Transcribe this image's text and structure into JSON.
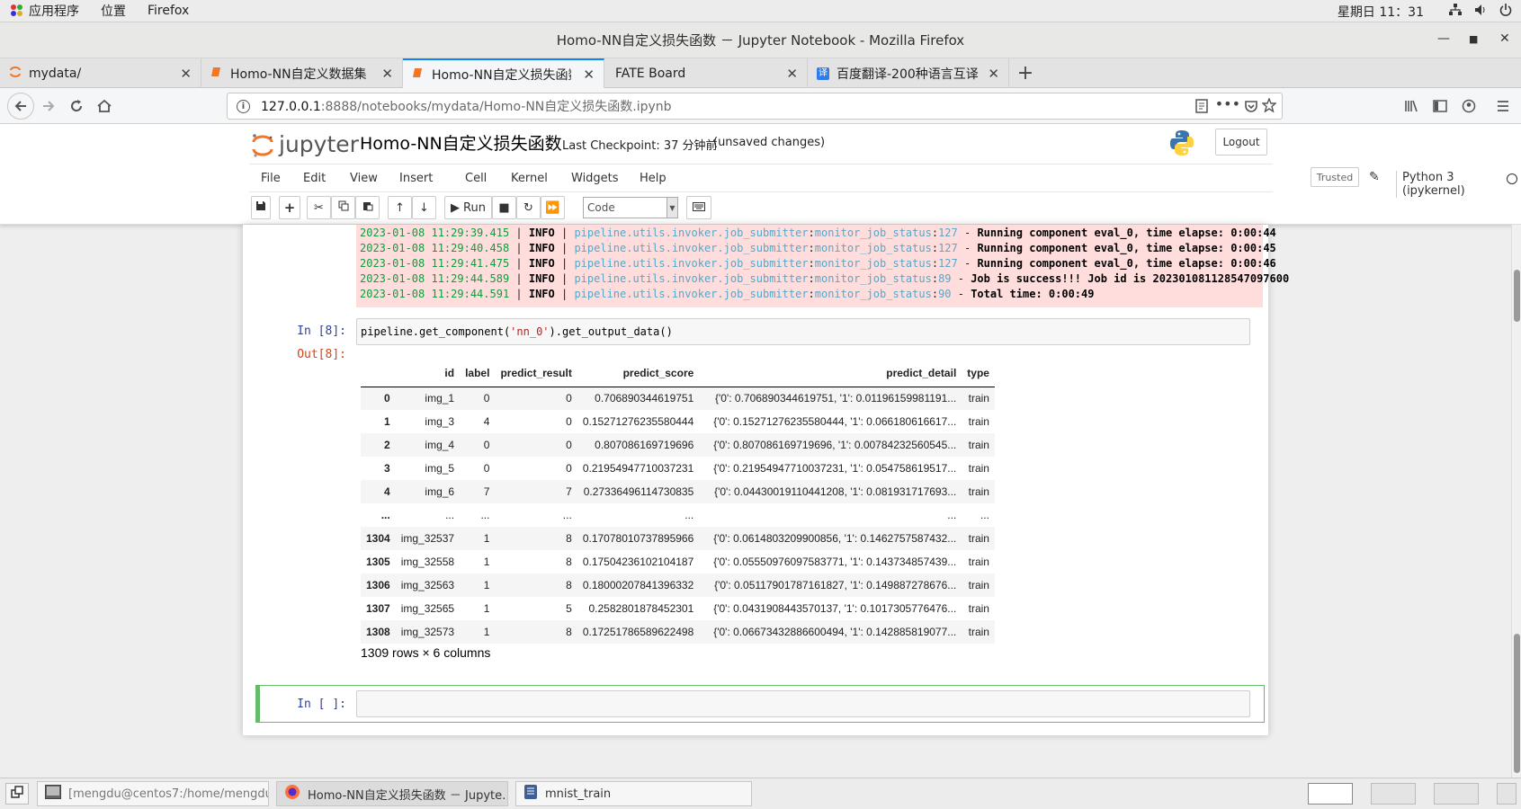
{
  "topbar": {
    "apps": "应用程序",
    "places": "位置",
    "app": "Firefox",
    "clock": "星期日 11：31"
  },
  "window": {
    "title": "Homo-NN自定义损失函数 － Jupyter Notebook - Mozilla Firefox"
  },
  "tabs": [
    {
      "label": "mydata/"
    },
    {
      "label": "Homo-NN自定义数据集"
    },
    {
      "label": "Homo-NN自定义损失函数"
    },
    {
      "label": "FATE Board"
    },
    {
      "label": "百度翻译-200种语言互译"
    }
  ],
  "url": {
    "host": "127.0.0.1",
    "rest": ":8888/notebooks/mydata/Homo-NN自定义损失函数.ipynb"
  },
  "jupyter": {
    "logo_text": "jupyter",
    "notebook_title": "Homo-NN自定义损失函数",
    "checkpoint": "Last Checkpoint: 37 分钟前",
    "unsaved": "(unsaved changes)",
    "logout": "Logout",
    "menus": [
      "File",
      "Edit",
      "View",
      "Insert",
      "Cell",
      "Kernel",
      "Widgets",
      "Help"
    ],
    "trusted": "Trusted",
    "kernel": "Python 3 (ipykernel)",
    "run_label": "Run",
    "cell_type": "Code"
  },
  "log": [
    {
      "ts": "2023-01-08 11:29:39.415",
      "level": "INFO",
      "module": "pipeline.utils.invoker.job_submitter",
      "func": "monitor_job_status",
      "line": "127",
      "msg": "Running component eval_0, time elapse: 0:00:44"
    },
    {
      "ts": "2023-01-08 11:29:40.458",
      "level": "INFO",
      "module": "pipeline.utils.invoker.job_submitter",
      "func": "monitor_job_status",
      "line": "127",
      "msg": "Running component eval_0, time elapse: 0:00:45"
    },
    {
      "ts": "2023-01-08 11:29:41.475",
      "level": "INFO",
      "module": "pipeline.utils.invoker.job_submitter",
      "func": "monitor_job_status",
      "line": "127",
      "msg": "Running component eval_0, time elapse: 0:00:46"
    },
    {
      "ts": "2023-01-08 11:29:44.589",
      "level": "INFO",
      "module": "pipeline.utils.invoker.job_submitter",
      "func": "monitor_job_status",
      "line": "89",
      "msg": "Job is success!!! Job id is 202301081128547097600"
    },
    {
      "ts": "2023-01-08 11:29:44.591",
      "level": "INFO",
      "module": "pipeline.utils.invoker.job_submitter",
      "func": "monitor_job_status",
      "line": "90",
      "msg": "Total time: 0:00:49"
    }
  ],
  "cell8": {
    "in_prompt": "In [8]:",
    "out_prompt": "Out[8]:",
    "code_pre": "pipeline.get_component(",
    "code_str": "'nn_0'",
    "code_post": ").get_output_data()"
  },
  "dataframe": {
    "columns": [
      "",
      "id",
      "label",
      "predict_result",
      "predict_score",
      "predict_detail",
      "type"
    ],
    "rows": [
      [
        "0",
        "img_1",
        "0",
        "0",
        "0.706890344619751",
        "{'0': 0.706890344619751, '1': 0.01196159981191...",
        "train"
      ],
      [
        "1",
        "img_3",
        "4",
        "0",
        "0.15271276235580444",
        "{'0': 0.15271276235580444, '1': 0.066180616617...",
        "train"
      ],
      [
        "2",
        "img_4",
        "0",
        "0",
        "0.807086169719696",
        "{'0': 0.807086169719696, '1': 0.00784232560545...",
        "train"
      ],
      [
        "3",
        "img_5",
        "0",
        "0",
        "0.21954947710037231",
        "{'0': 0.21954947710037231, '1': 0.054758619517...",
        "train"
      ],
      [
        "4",
        "img_6",
        "7",
        "7",
        "0.27336496114730835",
        "{'0': 0.04430019110441208, '1': 0.081931717693...",
        "train"
      ],
      [
        "...",
        "...",
        "...",
        "...",
        "...",
        "...",
        "..."
      ],
      [
        "1304",
        "img_32537",
        "1",
        "8",
        "0.17078010737895966",
        "{'0': 0.0614803209900856, '1': 0.1462757587432...",
        "train"
      ],
      [
        "1305",
        "img_32558",
        "1",
        "8",
        "0.17504236102104187",
        "{'0': 0.05550976097583771, '1': 0.143734857439...",
        "train"
      ],
      [
        "1306",
        "img_32563",
        "1",
        "8",
        "0.18000207841396332",
        "{'0': 0.05117901787161827, '1': 0.149887278676...",
        "train"
      ],
      [
        "1307",
        "img_32565",
        "1",
        "5",
        "0.2582801878452301",
        "{'0': 0.0431908443570137, '1': 0.1017305776476...",
        "train"
      ],
      [
        "1308",
        "img_32573",
        "1",
        "8",
        "0.17251786589622498",
        "{'0': 0.06673432886600494, '1': 0.142885819077...",
        "train"
      ]
    ],
    "shape": "1309 rows × 6 columns"
  },
  "empty_cell": {
    "prompt": "In [ ]:"
  },
  "taskbar": {
    "items": [
      {
        "label": "[mengdu@centos7:/home/mengdu/…"
      },
      {
        "label": "Homo-NN自定义损失函数 － Jupyte…"
      },
      {
        "label": "mnist_train"
      }
    ]
  },
  "colors": {
    "accent": "#0a84ff",
    "stderr_bg": "#ffdddd",
    "in_prompt": "#303f9f",
    "out_prompt": "#d84315"
  }
}
